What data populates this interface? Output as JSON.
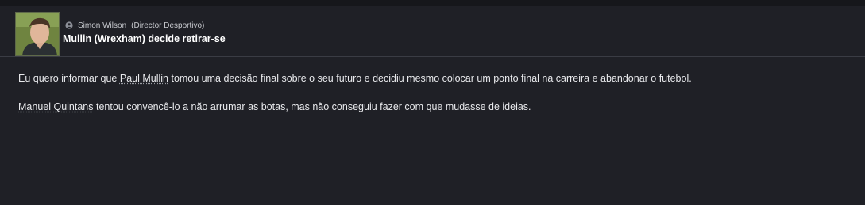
{
  "header": {
    "sender_name": "Simon Wilson",
    "sender_role": "(Director Desportivo)",
    "title": "Mullin (Wrexham) decide retirar-se",
    "sender_icon": "person-icon",
    "avatar": "player-photo"
  },
  "message": {
    "para1_before": "Eu quero informar que ",
    "para1_link": "Paul Mullin",
    "para1_after": " tomou uma decisão final sobre o seu futuro e decidiu mesmo colocar um ponto final na carreira e abandonar o futebol.",
    "para2_link": "Manuel Quintans",
    "para2_after": " tentou convencê-lo a não arrumar as botas, mas não conseguiu fazer com que mudasse de ideias."
  },
  "colors": {
    "background": "#1f2026",
    "title": "#ffffff",
    "text": "#e8e9ec"
  }
}
